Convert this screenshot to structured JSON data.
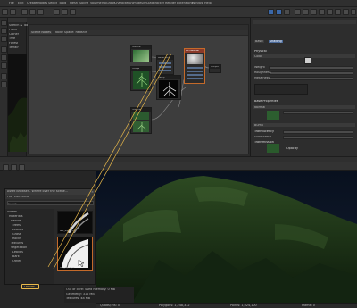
{
  "menu": [
    "File",
    "Edit",
    "Create",
    "Modes",
    "Select",
    "Tools",
    "Mesh",
    "Spline",
    "Volume",
    "MoGraph",
    "Character",
    "Animate",
    "Simulate",
    "Tracker",
    "Render",
    "Extensions",
    "Window",
    "Help"
  ],
  "object_manager": {
    "items": [
      "Sketch & Toon",
      "Plane",
      "Cloner",
      "Tree",
      "Forest",
      "Terrain"
    ]
  },
  "node_editor": {
    "tabs": [
      "Scene Nodes",
      "Node Space: Redshift"
    ],
    "nodes": [
      "Texture",
      "Image",
      "Reflection",
      "Ramp",
      "Texture",
      "RS Material",
      "Output"
    ]
  },
  "attributes": {
    "tabs": [
      "Basic",
      "Shading"
    ],
    "sections": [
      "Physical",
      "Base Properties",
      "Translucency",
      "Transmission",
      "Opacity"
    ],
    "labels": [
      "Color",
      "Weight",
      "Roughness",
      "Metalness",
      "Normal",
      "Bump",
      "Subsurface",
      "Sheen",
      "Coat",
      "Emission"
    ],
    "swatch_color": "#cfcfcf"
  },
  "browser": {
    "title": "Asset Browser - Where over the scene...",
    "menu": [
      "File",
      "Edit",
      "View"
    ],
    "search_placeholder": "Search",
    "tree": [
      "Assets",
      "Materials",
      "Nature",
      "Trees",
      "Leaves",
      "Grass",
      "Rocks",
      "Textures",
      "Vegetation",
      "Leaves",
      "Bark",
      "Other"
    ],
    "selected": "Leaves",
    "previews": [
      "leaf_alpha_01",
      "leaf_alpha_02"
    ]
  },
  "status_bar": {
    "items": [
      "Quads/Tris: 0",
      "Polygons: 1,248,332",
      "Points: 1,024,100",
      "Frame: 0"
    ]
  },
  "info_box": {
    "lines": [
      "Out of core: used memory: 0 MB",
      "Geometry: 312 MB",
      "Textures: 48 MB"
    ]
  },
  "colors": {
    "accent": "#e8b84a",
    "node_selected": "#c46a2a",
    "foliage": "#1f3a1c"
  }
}
